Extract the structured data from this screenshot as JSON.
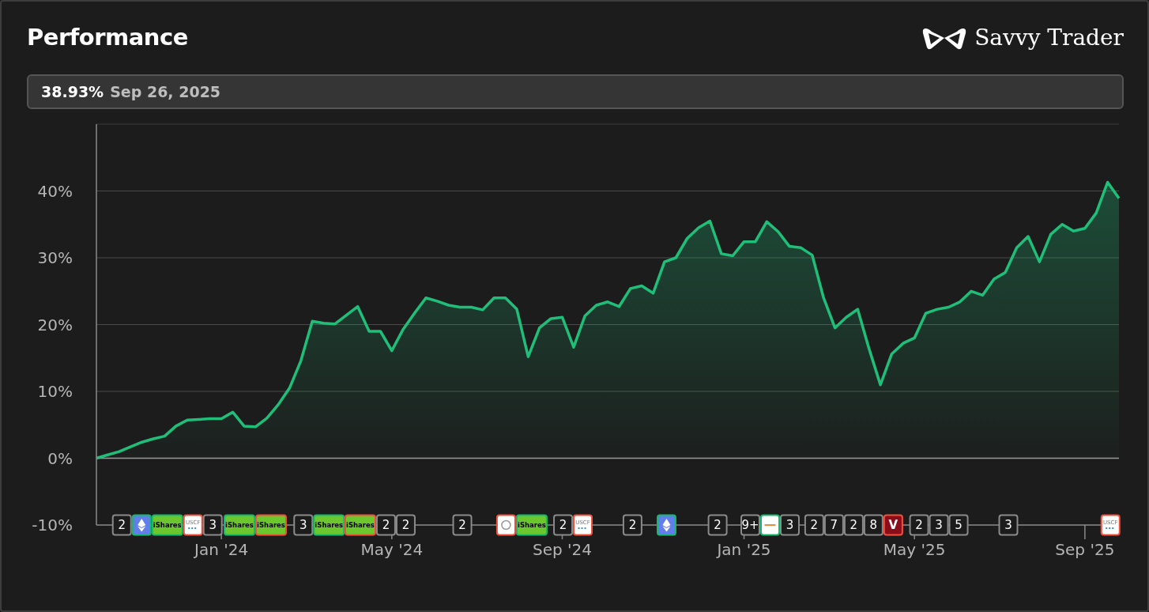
{
  "header": {
    "title": "Performance",
    "brand": "Savvy Trader"
  },
  "readout": {
    "value": "38.93%",
    "date": "Sep 26, 2025"
  },
  "chart_data": {
    "type": "area",
    "ylim": [
      -10,
      50
    ],
    "grid": true,
    "yticks": [
      {
        "value": -10,
        "label": "-10%"
      },
      {
        "value": 0,
        "label": "0%"
      },
      {
        "value": 10,
        "label": "10%"
      },
      {
        "value": 20,
        "label": "20%"
      },
      {
        "value": 30,
        "label": "30%"
      },
      {
        "value": 40,
        "label": "40%"
      }
    ],
    "categories": [
      null,
      null,
      null,
      null,
      null,
      null,
      null,
      null,
      null,
      null,
      null,
      "Jan '24",
      null,
      null,
      null,
      null,
      null,
      null,
      null,
      null,
      null,
      null,
      null,
      null,
      null,
      null,
      "May '24",
      null,
      null,
      null,
      null,
      null,
      null,
      null,
      null,
      null,
      null,
      null,
      null,
      null,
      null,
      "Sep '24",
      null,
      null,
      null,
      null,
      null,
      null,
      null,
      null,
      null,
      null,
      null,
      null,
      null,
      null,
      null,
      "Jan '25",
      null,
      null,
      null,
      null,
      null,
      null,
      null,
      null,
      null,
      null,
      null,
      null,
      null,
      null,
      "May '25",
      null,
      null,
      null,
      null,
      null,
      null,
      null,
      null,
      null,
      null,
      null,
      null,
      null,
      null,
      "Sep '25",
      null,
      null,
      null
    ],
    "series": [
      {
        "color": "#1fbf7a",
        "values": [
          0,
          0.5,
          1,
          1.7,
          2.4,
          2.9,
          3.3,
          4.8,
          5.7,
          5.8,
          5.9,
          5.9,
          6.9,
          4.8,
          4.7,
          6,
          8,
          10.5,
          14.6,
          20.5,
          20.2,
          20.1,
          21.4,
          22.7,
          19,
          19,
          16.1,
          19.3,
          21.7,
          24,
          23.5,
          22.9,
          22.6,
          22.6,
          22.2,
          24,
          24,
          22.3,
          15.2,
          19.5,
          20.9,
          21.1,
          16.6,
          21.3,
          22.9,
          23.4,
          22.7,
          25.4,
          25.8,
          24.7,
          29.4,
          30,
          32.9,
          34.5,
          35.5,
          30.6,
          30.3,
          32.4,
          32.4,
          35.4,
          33.9,
          31.7,
          31.5,
          30.4,
          24,
          19.5,
          21.1,
          22.3,
          16.4,
          11,
          15.6,
          17.2,
          18,
          21.7,
          22.3,
          22.6,
          23.4,
          25,
          24.4,
          26.8,
          27.8,
          31.5,
          33.2,
          29.4,
          33.5,
          35,
          34,
          34.4,
          36.7,
          41.3,
          38.9
        ]
      }
    ]
  },
  "event_markers": [
    {
      "items": [
        {
          "kind": "count",
          "label": "2"
        },
        {
          "kind": "eth",
          "color": "#16b86e"
        },
        {
          "kind": "ishares",
          "label": "iShares",
          "color": "#16b86e"
        },
        {
          "kind": "uscf",
          "label": "USCF",
          "color": "#f0503c"
        },
        {
          "kind": "count",
          "label": "3"
        }
      ]
    },
    {
      "items": [
        {
          "kind": "ishares",
          "label": "iShares",
          "color": "#16b86e"
        },
        {
          "kind": "ishares",
          "label": "iShares",
          "color": "#f0503c"
        }
      ]
    },
    {
      "items": [
        {
          "kind": "count",
          "label": "3"
        },
        {
          "kind": "ishares",
          "label": "iShares",
          "color": "#16b86e"
        }
      ]
    },
    {
      "items": [
        {
          "kind": "ishares",
          "label": "iShares",
          "color": "#f0503c"
        },
        {
          "kind": "count",
          "label": "2"
        },
        {
          "kind": "count",
          "label": "2"
        }
      ]
    },
    {
      "items": [
        {
          "kind": "count",
          "label": "2"
        }
      ]
    },
    {
      "items": [
        {
          "kind": "circle",
          "color": "#f0503c"
        },
        {
          "kind": "ishares",
          "label": "iShares",
          "color": "#16b86e"
        }
      ]
    },
    {
      "items": [
        {
          "kind": "count",
          "label": "2"
        },
        {
          "kind": "uscf",
          "label": "USCF",
          "color": "#f0503c"
        }
      ]
    },
    {
      "items": [
        {
          "kind": "count",
          "label": "2"
        }
      ]
    },
    {
      "items": [
        {
          "kind": "eth",
          "color": "#16b86e"
        }
      ]
    },
    {
      "items": [
        {
          "kind": "count",
          "label": "2"
        }
      ]
    },
    {
      "items": [
        {
          "kind": "count",
          "label": "9+"
        },
        {
          "kind": "banner",
          "color": "#16b86e"
        },
        {
          "kind": "count",
          "label": "3"
        }
      ]
    },
    {
      "items": [
        {
          "kind": "count",
          "label": "2"
        },
        {
          "kind": "count",
          "label": "7"
        },
        {
          "kind": "count",
          "label": "2"
        },
        {
          "kind": "count",
          "label": "8"
        },
        {
          "kind": "v",
          "label": "V",
          "color": "#f0503c"
        }
      ]
    },
    {
      "items": [
        {
          "kind": "count",
          "label": "2"
        },
        {
          "kind": "count",
          "label": "3"
        },
        {
          "kind": "count",
          "label": "5"
        }
      ]
    },
    {
      "items": [
        {
          "kind": "count",
          "label": "3"
        }
      ]
    },
    {
      "items": [
        {
          "kind": "uscf",
          "label": "USCF",
          "color": "#f0503c"
        }
      ]
    }
  ]
}
